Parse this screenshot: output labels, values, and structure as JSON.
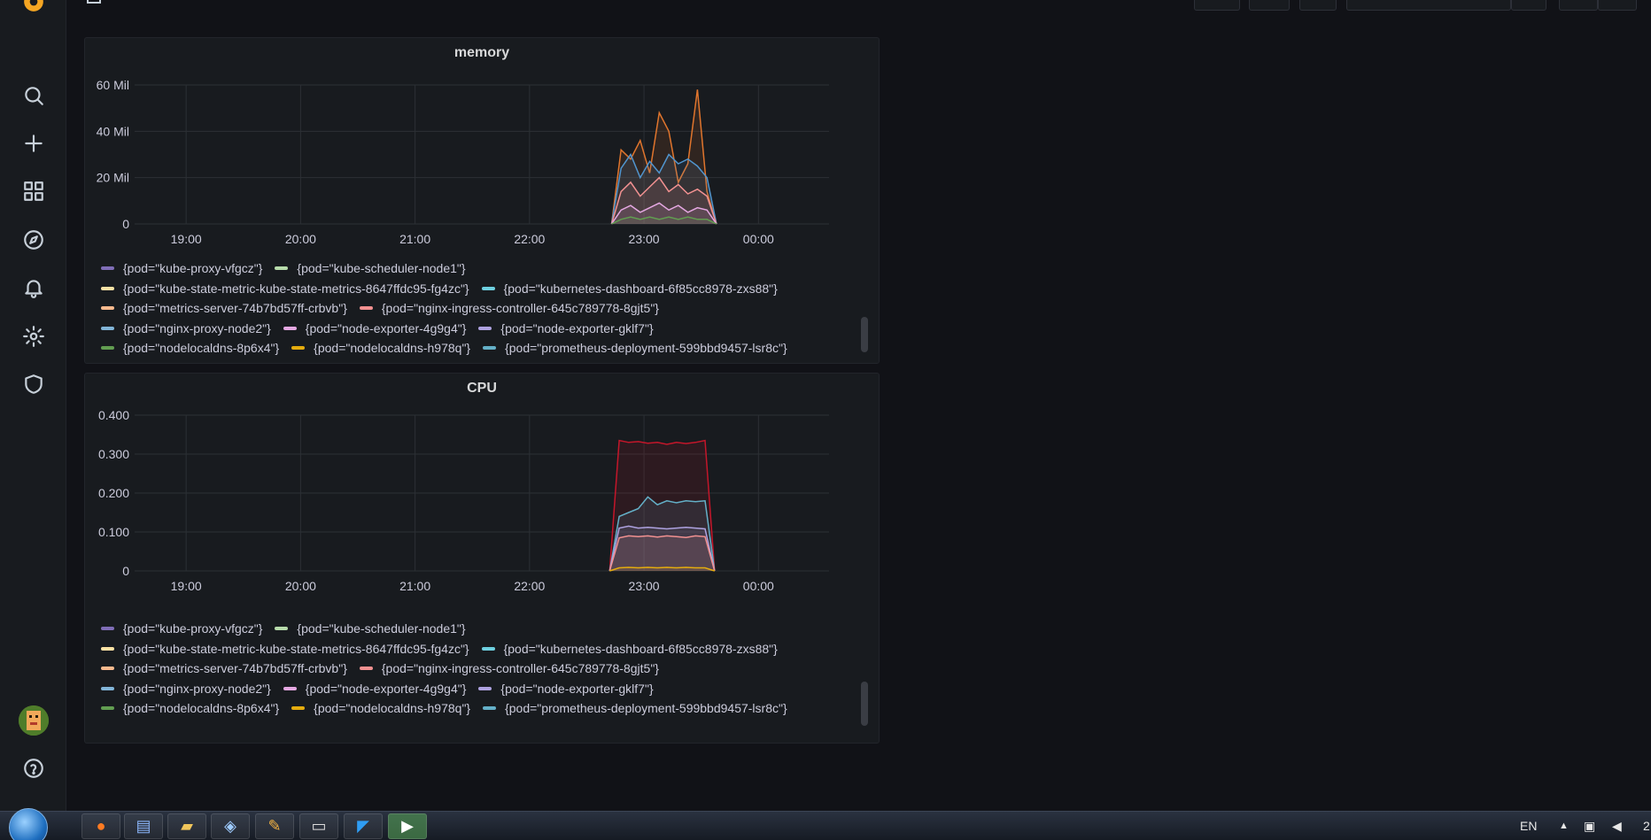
{
  "sidebar": {
    "items": [
      {
        "name": "logo-icon"
      },
      {
        "name": "search-icon"
      },
      {
        "name": "plus-icon"
      },
      {
        "name": "dashboards-icon"
      },
      {
        "name": "explore-compass-icon"
      },
      {
        "name": "alerting-bell-icon"
      },
      {
        "name": "configuration-gear-icon"
      },
      {
        "name": "server-admin-shield-icon"
      },
      {
        "name": "help-icon"
      }
    ],
    "avatar": "user-avatar"
  },
  "panels": [
    {
      "title": "memory",
      "legend_rows": [
        [
          [
            "#806eb7",
            "{pod=\"kube-proxy-vfgcz\"}"
          ],
          [
            "#b7dbab",
            "{pod=\"kube-scheduler-node1\"}"
          ]
        ],
        [
          [
            "#fce2a5",
            "{pod=\"kube-state-metric-kube-state-metrics-8647ffdc95-fg4zc\"}"
          ],
          [
            "#6ed0e0",
            "{pod=\"kubernetes-dashboard-6f85cc8978-zxs88\"}"
          ]
        ],
        [
          [
            "#f9ba8f",
            "{pod=\"metrics-server-74b7bd57ff-crbvb\"}"
          ],
          [
            "#f29191",
            "{pod=\"nginx-ingress-controller-645c789778-8gjt5\"}"
          ]
        ],
        [
          [
            "#82b5d8",
            "{pod=\"nginx-proxy-node2\"}"
          ],
          [
            "#e5a8e2",
            "{pod=\"node-exporter-4g9g4\"}"
          ],
          [
            "#aea2e0",
            "{pod=\"node-exporter-gklf7\"}"
          ]
        ],
        [
          [
            "#629e51",
            "{pod=\"nodelocaldns-8p6x4\"}"
          ],
          [
            "#e5ac0e",
            "{pod=\"nodelocaldns-h978q\"}"
          ],
          [
            "#64b0c8",
            "{pod=\"prometheus-deployment-599bbd9457-lsr8c\"}"
          ]
        ]
      ]
    },
    {
      "title": "CPU",
      "legend_rows": [
        [
          [
            "#806eb7",
            "{pod=\"kube-proxy-vfgcz\"}"
          ],
          [
            "#b7dbab",
            "{pod=\"kube-scheduler-node1\"}"
          ]
        ],
        [
          [
            "#fce2a5",
            "{pod=\"kube-state-metric-kube-state-metrics-8647ffdc95-fg4zc\"}"
          ],
          [
            "#6ed0e0",
            "{pod=\"kubernetes-dashboard-6f85cc8978-zxs88\"}"
          ]
        ],
        [
          [
            "#f9ba8f",
            "{pod=\"metrics-server-74b7bd57ff-crbvb\"}"
          ],
          [
            "#f29191",
            "{pod=\"nginx-ingress-controller-645c789778-8gjt5\"}"
          ]
        ],
        [
          [
            "#82b5d8",
            "{pod=\"nginx-proxy-node2\"}"
          ],
          [
            "#e5a8e2",
            "{pod=\"node-exporter-4g9g4\"}"
          ],
          [
            "#aea2e0",
            "{pod=\"node-exporter-gklf7\"}"
          ]
        ],
        [
          [
            "#629e51",
            "{pod=\"nodelocaldns-8p6x4\"}"
          ],
          [
            "#e5ac0e",
            "{pod=\"nodelocaldns-h978q\"}"
          ],
          [
            "#64b0c8",
            "{pod=\"prometheus-deployment-599bbd9457-lsr8c\"}"
          ]
        ]
      ]
    }
  ],
  "chart_data": [
    {
      "type": "line",
      "title": "memory",
      "x_ticks": [
        "19:00",
        "20:00",
        "21:00",
        "22:00",
        "23:00",
        "00:00"
      ],
      "y_ticks": [
        "0",
        "20 Mil",
        "40 Mil",
        "60 Mil"
      ],
      "ylim": [
        0,
        60000000
      ],
      "xlim": [
        "18:33",
        "00:37"
      ],
      "grid": true,
      "legend": "bottom",
      "series": [
        {
          "color": "#e0752d",
          "x": [
            "22:43",
            "22:48",
            "22:53",
            "22:58",
            "23:03",
            "23:08",
            "23:13",
            "23:18",
            "23:23",
            "23:28",
            "23:33",
            "23:38"
          ],
          "values": [
            0,
            32000000,
            28000000,
            36000000,
            22000000,
            48000000,
            40000000,
            18000000,
            26000000,
            58000000,
            14000000,
            0
          ]
        },
        {
          "color": "#5195ce",
          "x": [
            "22:43",
            "22:48",
            "22:53",
            "22:58",
            "23:03",
            "23:08",
            "23:13",
            "23:18",
            "23:23",
            "23:28",
            "23:33",
            "23:38"
          ],
          "values": [
            0,
            24000000,
            30000000,
            20000000,
            27000000,
            22000000,
            30000000,
            26000000,
            28000000,
            25000000,
            20000000,
            0
          ]
        },
        {
          "color": "#f29191",
          "x": [
            "22:43",
            "22:48",
            "22:53",
            "22:58",
            "23:03",
            "23:08",
            "23:13",
            "23:18",
            "23:23",
            "23:28",
            "23:33",
            "23:38"
          ],
          "values": [
            0,
            14000000,
            18000000,
            12000000,
            16000000,
            20000000,
            14000000,
            17000000,
            13000000,
            15000000,
            12000000,
            0
          ]
        },
        {
          "color": "#e5a8e2",
          "x": [
            "22:43",
            "22:48",
            "22:53",
            "22:58",
            "23:03",
            "23:08",
            "23:13",
            "23:18",
            "23:23",
            "23:28",
            "23:33",
            "23:38"
          ],
          "values": [
            0,
            6000000,
            8000000,
            5000000,
            7000000,
            9000000,
            6000000,
            8000000,
            5000000,
            7000000,
            6000000,
            0
          ]
        },
        {
          "color": "#629e51",
          "x": [
            "22:43",
            "22:48",
            "22:53",
            "22:58",
            "23:03",
            "23:08",
            "23:13",
            "23:18",
            "23:23",
            "23:28",
            "23:33",
            "23:38"
          ],
          "values": [
            0,
            2000000,
            3000000,
            2000000,
            3000000,
            2000000,
            3000000,
            2000000,
            3000000,
            2000000,
            2000000,
            0
          ]
        }
      ]
    },
    {
      "type": "line",
      "title": "CPU",
      "x_ticks": [
        "19:00",
        "20:00",
        "21:00",
        "22:00",
        "23:00",
        "00:00"
      ],
      "y_ticks": [
        "0",
        "0.100",
        "0.200",
        "0.300",
        "0.400"
      ],
      "ylim": [
        0,
        0.4
      ],
      "xlim": [
        "18:33",
        "00:37"
      ],
      "grid": true,
      "legend": "bottom",
      "series": [
        {
          "color": "#c4162a",
          "x": [
            "22:42",
            "22:47",
            "22:52",
            "22:57",
            "23:02",
            "23:07",
            "23:12",
            "23:17",
            "23:22",
            "23:27",
            "23:32",
            "23:37"
          ],
          "values": [
            0,
            0.335,
            0.33,
            0.332,
            0.328,
            0.33,
            0.325,
            0.33,
            0.327,
            0.33,
            0.335,
            0
          ]
        },
        {
          "color": "#64b0c8",
          "x": [
            "22:42",
            "22:47",
            "22:52",
            "22:57",
            "23:02",
            "23:07",
            "23:12",
            "23:17",
            "23:22",
            "23:27",
            "23:32",
            "23:37"
          ],
          "values": [
            0,
            0.14,
            0.15,
            0.16,
            0.19,
            0.17,
            0.18,
            0.175,
            0.18,
            0.178,
            0.18,
            0
          ]
        },
        {
          "color": "#aea2e0",
          "x": [
            "22:42",
            "22:47",
            "22:52",
            "22:57",
            "23:02",
            "23:07",
            "23:12",
            "23:17",
            "23:22",
            "23:27",
            "23:32",
            "23:37"
          ],
          "values": [
            0,
            0.11,
            0.115,
            0.11,
            0.112,
            0.11,
            0.108,
            0.11,
            0.112,
            0.11,
            0.108,
            0
          ]
        },
        {
          "color": "#f29191",
          "x": [
            "22:42",
            "22:47",
            "22:52",
            "22:57",
            "23:02",
            "23:07",
            "23:12",
            "23:17",
            "23:22",
            "23:27",
            "23:32",
            "23:37"
          ],
          "values": [
            0,
            0.085,
            0.09,
            0.088,
            0.09,
            0.087,
            0.09,
            0.088,
            0.086,
            0.09,
            0.088,
            0
          ]
        },
        {
          "color": "#e5ac0e",
          "x": [
            "22:42",
            "22:47",
            "22:52",
            "22:57",
            "23:02",
            "23:07",
            "23:12",
            "23:17",
            "23:22",
            "23:27",
            "23:32",
            "23:37"
          ],
          "values": [
            0,
            0.008,
            0.009,
            0.008,
            0.009,
            0.008,
            0.009,
            0.008,
            0.009,
            0.008,
            0.008,
            0
          ]
        }
      ]
    }
  ],
  "taskbar": {
    "buttons": [
      "firefox",
      "notepad",
      "explorer",
      "virtualbox",
      "paint",
      "terminal",
      "vscode",
      "app-green"
    ],
    "lang": "EN",
    "clock_fragment": "2"
  }
}
